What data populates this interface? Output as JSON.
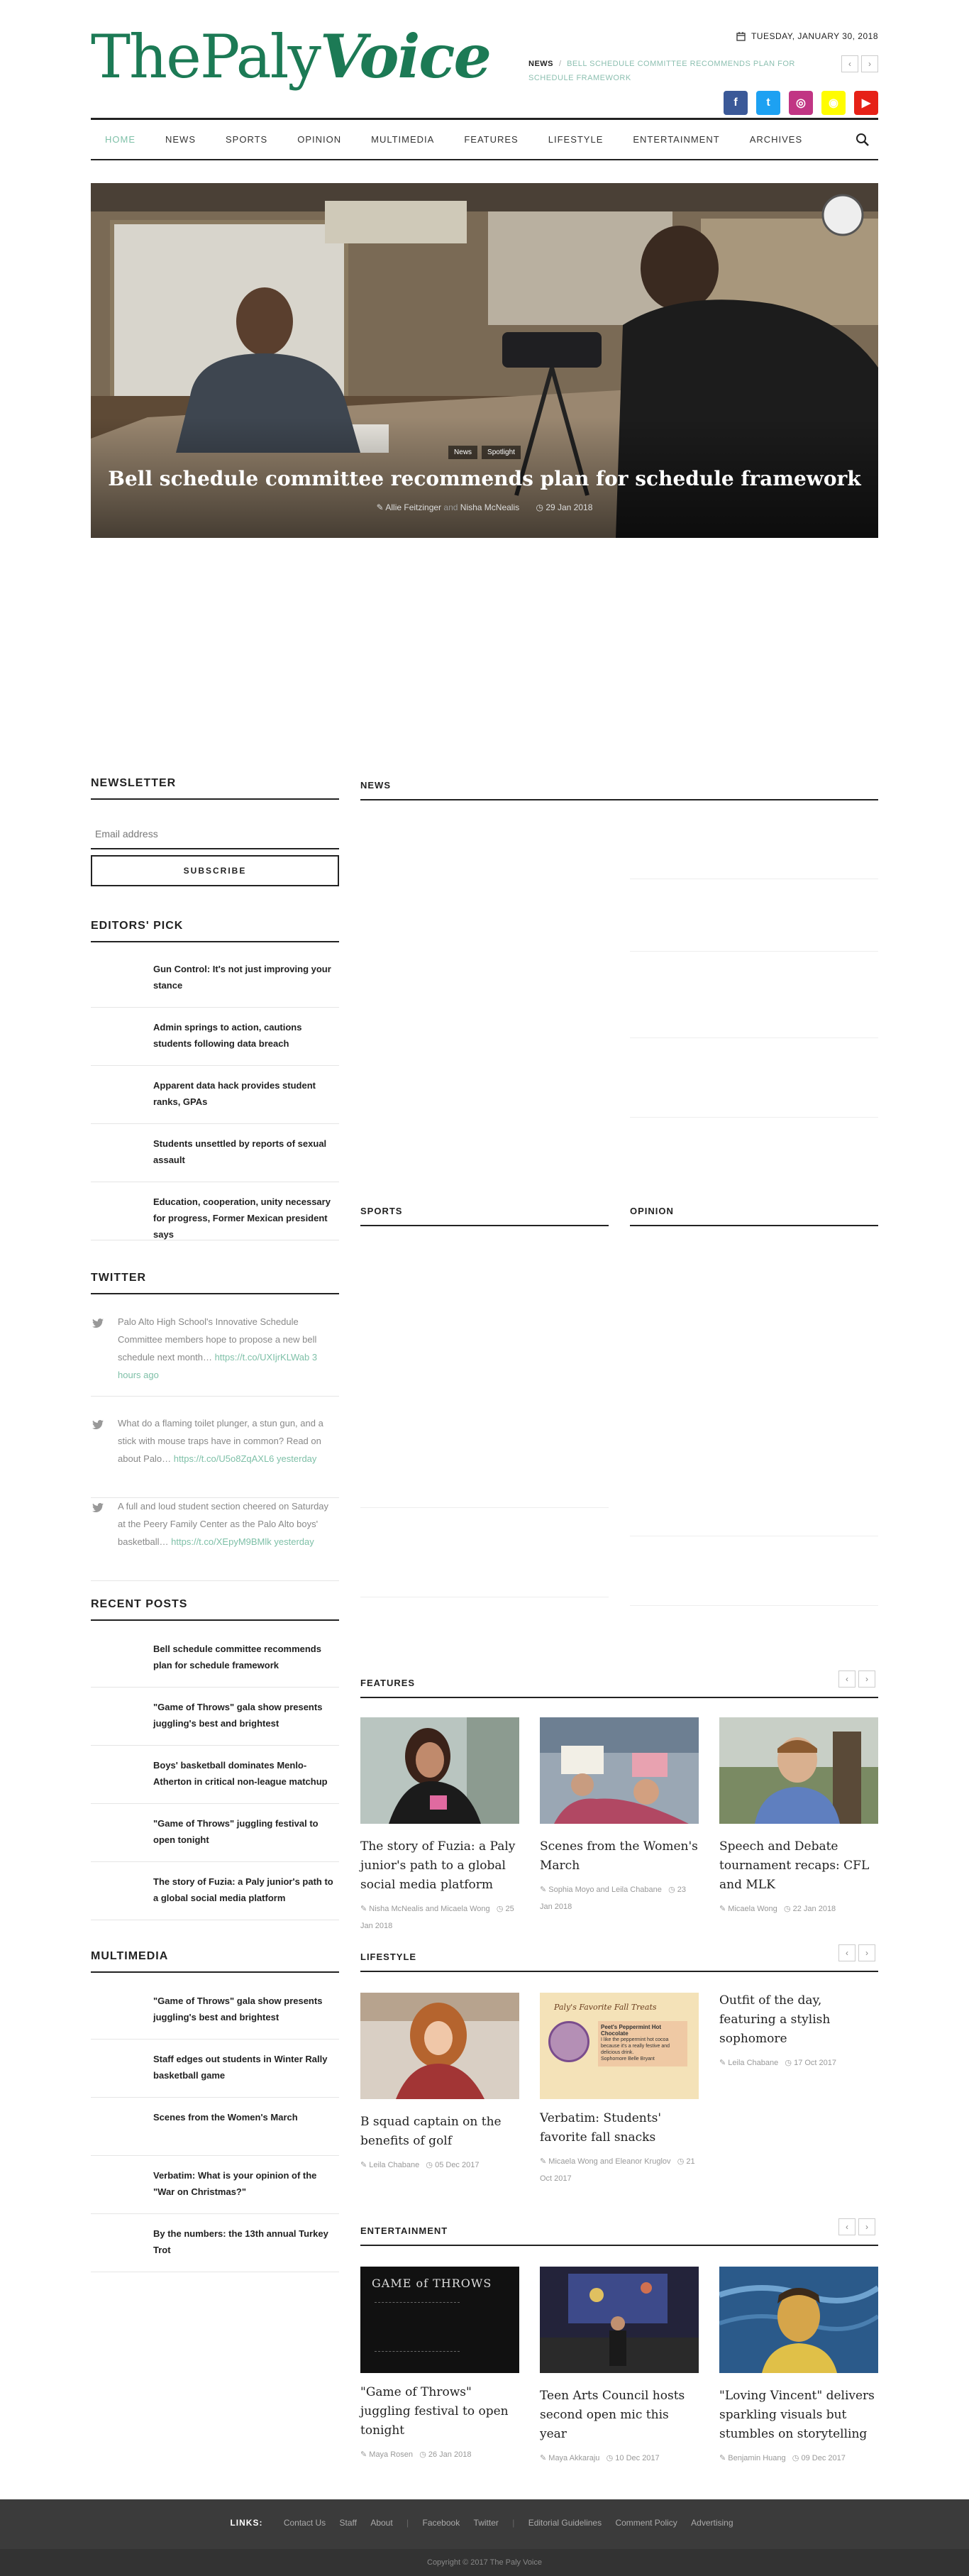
{
  "header": {
    "logo_part1": "ThePaly",
    "logo_part2": "Voice",
    "date": "TUESDAY, JANUARY 30, 2018",
    "ticker_label": "NEWS",
    "ticker_text": "BELL SCHEDULE COMMITTEE RECOMMENDS PLAN FOR SCHEDULE FRAMEWORK",
    "socials": [
      {
        "icon": "facebook-icon",
        "glyph": "f",
        "color": "#3b5998"
      },
      {
        "icon": "twitter-icon",
        "glyph": "t",
        "color": "#1da1f2"
      },
      {
        "icon": "instagram-icon",
        "glyph": "◎",
        "color": "#c13584"
      },
      {
        "icon": "snapchat-icon",
        "glyph": "◉",
        "color": "#fffc00"
      },
      {
        "icon": "youtube-icon",
        "glyph": "▶",
        "color": "#e62117"
      }
    ]
  },
  "nav": {
    "items": [
      "HOME",
      "NEWS",
      "SPORTS",
      "OPINION",
      "MULTIMEDIA",
      "FEATURES",
      "LIFESTYLE",
      "ENTERTAINMENT",
      "ARCHIVES"
    ]
  },
  "hero": {
    "tag1": "News",
    "tag2": "Spotlight",
    "title": "Bell schedule committee recommends plan for schedule framework",
    "author": "Allie Feitzinger",
    "and": "and",
    "author2": "Nisha McNealis",
    "date": "29 Jan 2018"
  },
  "sidebar": {
    "newsletter_title": "NEWSLETTER",
    "email_placeholder": "Email address",
    "subscribe_label": "SUBSCRIBE",
    "editors_title": "EDITORS' PICK",
    "editors": [
      "Gun Control: It's not just improving your stance",
      "Admin springs to action, cautions students following data breach",
      "Apparent data hack provides student ranks, GPAs",
      "Students unsettled by reports of sexual assault",
      "Education, cooperation, unity necessary for progress, Former Mexican president says"
    ],
    "twitter_title": "TWITTER",
    "tweets": [
      {
        "text": "Palo Alto High School's Innovative Schedule Committee members hope to propose a new bell schedule next month… ",
        "link": "https://t.co/UXIjrKLWab",
        "time": "3 hours ago"
      },
      {
        "text": "What do a flaming toilet plunger, a stun gun, and a stick with mouse traps have in common? Read on about Palo… ",
        "link": "https://t.co/U5o8ZqAXL6",
        "time": "yesterday"
      },
      {
        "text": "A full and loud student section cheered on Saturday at the Peery Family Center as the Palo Alto boys' basketball… ",
        "link": "https://t.co/XEpyM9BMlk",
        "time": "yesterday"
      }
    ],
    "recent_title": "RECENT POSTS",
    "recent": [
      "Bell schedule committee recommends plan for schedule framework",
      "\"Game of Throws\" gala show presents juggling's best and brightest",
      "Boys' basketball dominates Menlo-Atherton in critical non-league matchup",
      "\"Game of Throws\" juggling festival to open tonight",
      "The story of Fuzia: a Paly junior's path to a global social media platform"
    ],
    "multimedia_title": "MULTIMEDIA",
    "multimedia": [
      "\"Game of Throws\" gala show presents juggling's best and brightest",
      "Staff edges out students in Winter Rally basketball game",
      "Scenes from the Women's March",
      "Verbatim: What is your opinion of the \"War on Christmas?\"",
      "By the numbers: the 13th annual Turkey Trot"
    ]
  },
  "sections": {
    "news": "NEWS",
    "sports": "SPORTS",
    "opinion": "OPINION",
    "features": "FEATURES",
    "lifestyle": "LIFESTYLE",
    "entertainment": "ENTERTAINMENT"
  },
  "features": [
    {
      "title": "The story of Fuzia: a Paly junior's path to a global social media platform",
      "author": "Nisha McNealis and Micaela Wong",
      "date": "25 Jan 2018"
    },
    {
      "title": "Scenes from the Women's March",
      "author": "Sophia Moyo and Leila Chabane",
      "date": "23 Jan 2018"
    },
    {
      "title": "Speech and Debate tournament recaps: CFL and MLK",
      "author": "Micaela Wong",
      "date": "22 Jan 2018"
    }
  ],
  "lifestyle": [
    {
      "title": "B squad captain on the benefits of golf",
      "author": "Leila Chabane",
      "date": "05 Dec 2017"
    },
    {
      "title": "Verbatim: Students' favorite fall snacks",
      "author": "Micaela Wong and Eleanor Kruglov",
      "date": "21 Oct 2017",
      "image_heading": "Paly's Favorite Fall Treats",
      "image_item": "Peet's Peppermint Hot Chocolate",
      "image_text": "I like the peppermint hot cocoa because it's a really festive and delicious drink.",
      "image_credit": "Sophomore Belle Bryant"
    },
    {
      "title": "Outfit of the day, featuring a stylish sophomore",
      "author": "Leila Chabane",
      "date": "17 Oct 2017"
    }
  ],
  "entertainment": [
    {
      "title": "\"Game of Throws\" juggling festival to open tonight",
      "author": "Maya Rosen",
      "date": "26 Jan 2018",
      "image_title": "GAME of THROWS"
    },
    {
      "title": "Teen Arts Council hosts second open mic this year",
      "author": "Maya Akkaraju",
      "date": "10 Dec 2017"
    },
    {
      "title": "\"Loving Vincent\" delivers sparkling visuals but stumbles on storytelling",
      "author": "Benjamin Huang",
      "date": "09 Dec 2017"
    }
  ],
  "footer": {
    "links_label": "LINKS:",
    "group1": [
      "Contact Us",
      "Staff",
      "About"
    ],
    "group2": [
      "Facebook",
      "Twitter"
    ],
    "group3": [
      "Editorial Guidelines",
      "Comment Policy",
      "Advertising"
    ],
    "copyright": "Copyright © 2017 The Paly Voice"
  }
}
